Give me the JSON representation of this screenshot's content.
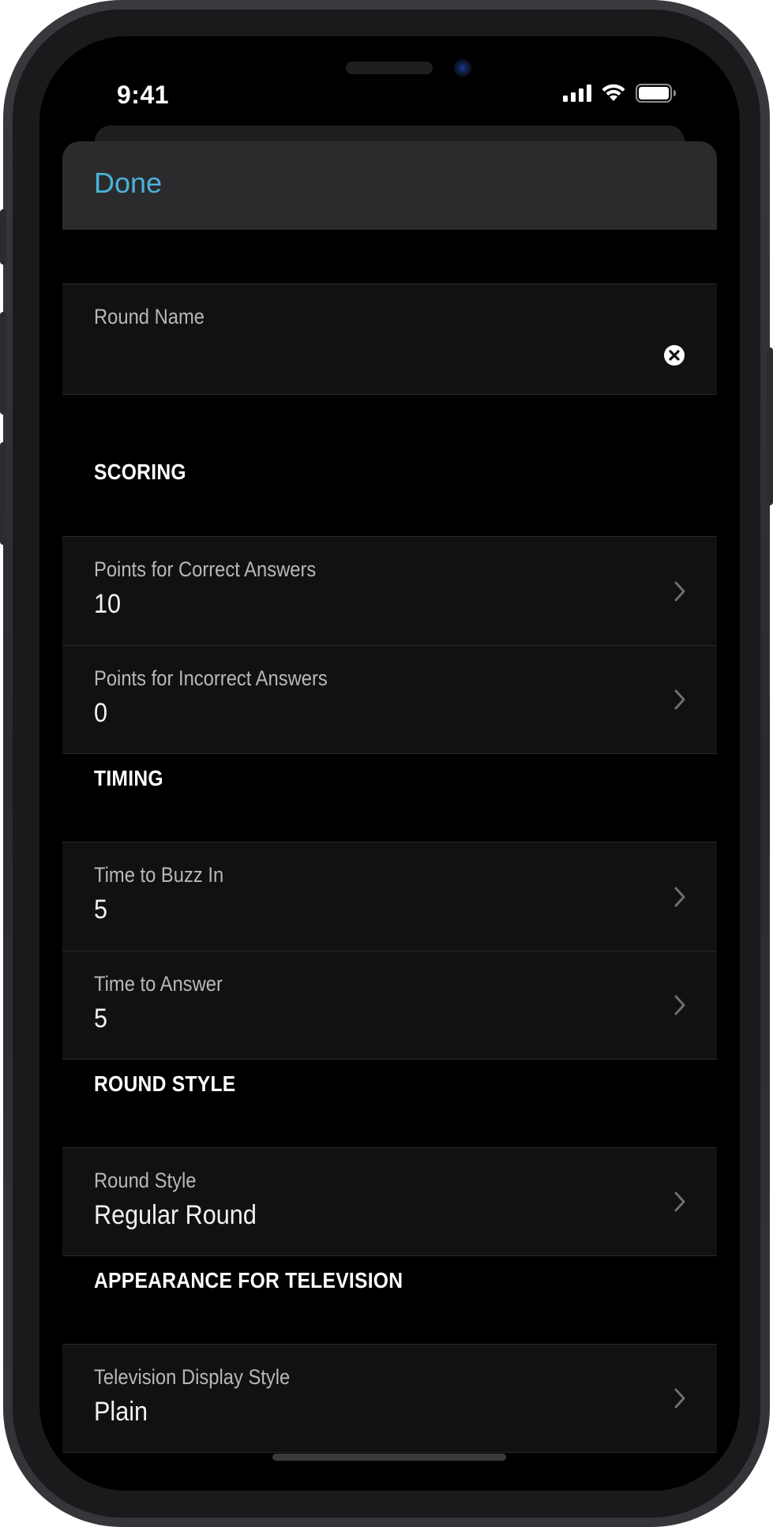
{
  "status_bar": {
    "time": "9:41"
  },
  "navbar": {
    "done_label": "Done"
  },
  "round_name": {
    "label": "Round Name",
    "value": ""
  },
  "sections": {
    "scoring": {
      "header": "SCORING",
      "correct": {
        "label": "Points for Correct Answers",
        "value": "10"
      },
      "incorrect": {
        "label": "Points for Incorrect Answers",
        "value": "0"
      }
    },
    "timing": {
      "header": "TIMING",
      "buzz_in": {
        "label": "Time to Buzz In",
        "value": "5"
      },
      "answer": {
        "label": "Time to Answer",
        "value": "5"
      }
    },
    "round_style": {
      "header": "ROUND STYLE",
      "style": {
        "label": "Round Style",
        "value": "Regular Round"
      }
    },
    "appearance": {
      "header": "APPEARANCE FOR TELEVISION",
      "display_style": {
        "label": "Television Display Style",
        "value": "Plain"
      }
    }
  },
  "colors": {
    "accent": "#49b3d8",
    "cell_background": "#111112",
    "navbar_background": "#2b2b2d"
  },
  "icons": {
    "clear": "clear-circle-icon",
    "disclosure": "chevron-right-icon"
  }
}
